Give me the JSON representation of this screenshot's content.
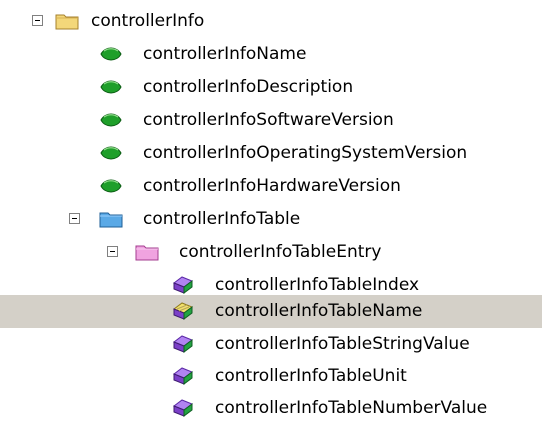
{
  "tree": {
    "nodes": [
      {
        "label": "controllerInfo",
        "icon": "folder-yellow-icon",
        "expanded": true,
        "selected": false
      },
      {
        "label": "controllerInfoName",
        "icon": "green-leaf-icon",
        "expanded": null,
        "selected": false
      },
      {
        "label": "controllerInfoDescription",
        "icon": "green-leaf-icon",
        "expanded": null,
        "selected": false
      },
      {
        "label": "controllerInfoSoftwareVersion",
        "icon": "green-leaf-icon",
        "expanded": null,
        "selected": false
      },
      {
        "label": "controllerInfoOperatingSystemVersion",
        "icon": "green-leaf-icon",
        "expanded": null,
        "selected": false
      },
      {
        "label": "controllerInfoHardwareVersion",
        "icon": "green-leaf-icon",
        "expanded": null,
        "selected": false
      },
      {
        "label": "controllerInfoTable",
        "icon": "folder-blue-icon",
        "expanded": true,
        "selected": false
      },
      {
        "label": "controllerInfoTableEntry",
        "icon": "folder-pink-icon",
        "expanded": true,
        "selected": false
      },
      {
        "label": "controllerInfoTableIndex",
        "icon": "table-column-icon",
        "expanded": null,
        "selected": false
      },
      {
        "label": "controllerInfoTableName",
        "icon": "table-column-key-icon",
        "expanded": null,
        "selected": true
      },
      {
        "label": "controllerInfoTableStringValue",
        "icon": "table-column-icon",
        "expanded": null,
        "selected": false
      },
      {
        "label": "controllerInfoTableUnit",
        "icon": "table-column-icon",
        "expanded": null,
        "selected": false
      },
      {
        "label": "controllerInfoTableNumberValue",
        "icon": "table-column-icon",
        "expanded": null,
        "selected": false
      }
    ]
  },
  "colors": {
    "selection": "#d4d0c8",
    "folder_yellow": "#f3d77a",
    "folder_blue": "#5aa9e6",
    "folder_pink": "#f0a3e0",
    "leaf_green": "#1f9f2a",
    "column_purple": "#7b3fc8",
    "column_green": "#22a341"
  }
}
